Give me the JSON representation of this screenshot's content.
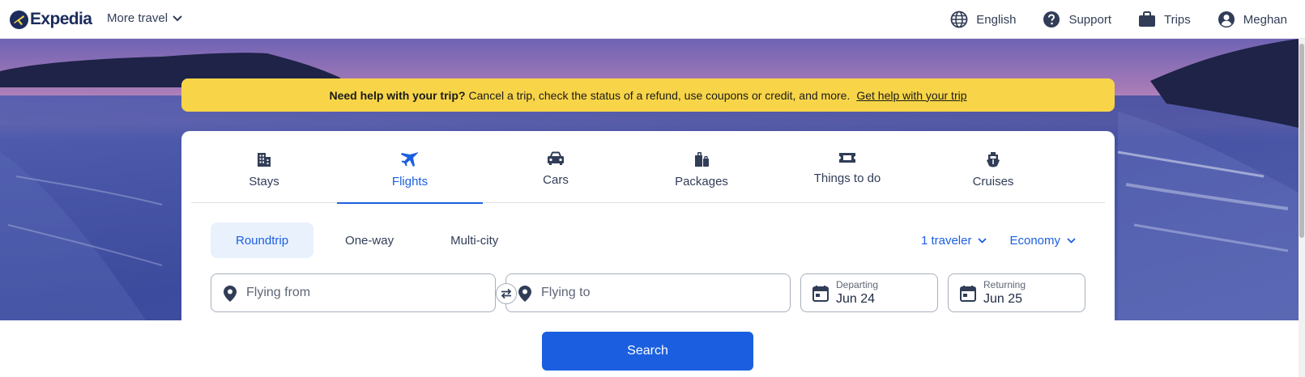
{
  "header": {
    "brand": "Expedia",
    "more_travel": "More travel",
    "nav": [
      {
        "label": "English",
        "icon": "globe-icon"
      },
      {
        "label": "Support",
        "icon": "help-icon"
      },
      {
        "label": "Trips",
        "icon": "briefcase-icon"
      },
      {
        "label": "Meghan",
        "icon": "account-icon"
      }
    ]
  },
  "banner": {
    "bold": "Need help with your trip?",
    "text": "Cancel a trip, check the status of a refund, use coupons or credit, and more.",
    "link": "Get help with your trip"
  },
  "tabs": [
    {
      "label": "Stays",
      "icon": "building-icon",
      "active": false
    },
    {
      "label": "Flights",
      "icon": "plane-icon",
      "active": true
    },
    {
      "label": "Cars",
      "icon": "car-icon",
      "active": false
    },
    {
      "label": "Packages",
      "icon": "packages-icon",
      "active": false
    },
    {
      "label": "Things to do",
      "icon": "ticket-icon",
      "active": false
    },
    {
      "label": "Cruises",
      "icon": "ship-icon",
      "active": false
    }
  ],
  "trip_types": [
    {
      "label": "Roundtrip",
      "active": true
    },
    {
      "label": "One-way",
      "active": false
    },
    {
      "label": "Multi-city",
      "active": false
    }
  ],
  "options": {
    "travelers": "1 traveler",
    "cabin": "Economy"
  },
  "fields": {
    "from_placeholder": "Flying from",
    "to_placeholder": "Flying to",
    "departing_label": "Departing",
    "departing_value": "Jun 24",
    "returning_label": "Returning",
    "returning_value": "Jun 25"
  },
  "search_label": "Search",
  "colors": {
    "brand_navy": "#1b2c5c",
    "accent_blue": "#1b5fe0",
    "banner_yellow": "#f8d548"
  }
}
